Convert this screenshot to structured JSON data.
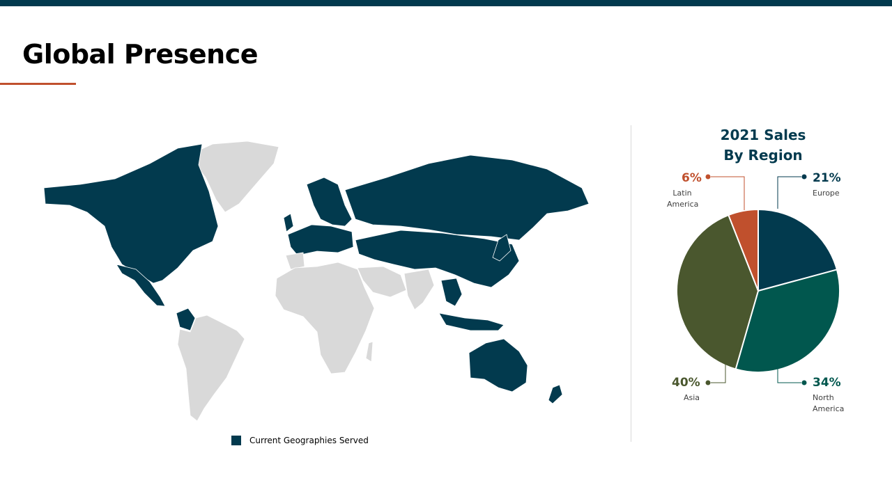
{
  "page": {
    "title": "Global Presence"
  },
  "map": {
    "legend_label": "Current Geographies Served"
  },
  "colors": {
    "served": "#023a4e",
    "unserved": "#d9d9d9",
    "accent": "#c0502d"
  },
  "chart_data": {
    "type": "pie",
    "title": "2021 Sales By Region",
    "title_lines": [
      "2021 Sales",
      "By Region"
    ],
    "slices": [
      {
        "label": "Europe",
        "label_lines": [
          "Europe"
        ],
        "value": 21,
        "value_label": "21%",
        "color": "#023a4e"
      },
      {
        "label": "North America",
        "label_lines": [
          "North",
          "America"
        ],
        "value": 34,
        "value_label": "34%",
        "color": "#01574e"
      },
      {
        "label": "Asia",
        "label_lines": [
          "Asia"
        ],
        "value": 40,
        "value_label": "40%",
        "color": "#4a572e"
      },
      {
        "label": "Latin America",
        "label_lines": [
          "Latin",
          "America"
        ],
        "value": 6,
        "value_label": "6%",
        "color": "#c0502d"
      }
    ]
  }
}
